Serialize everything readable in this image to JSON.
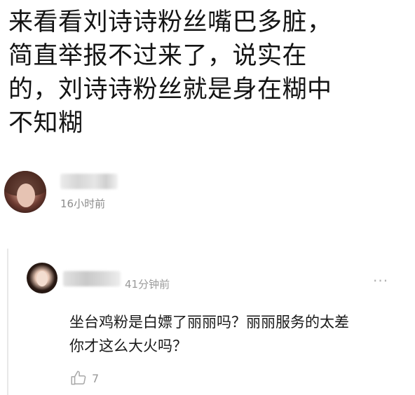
{
  "post": {
    "lines": [
      "来看看刘诗诗粉丝嘴巴多脏，",
      "简直举报不过来了，说实在",
      "的，刘诗诗粉丝就是身在糊中",
      "不知糊"
    ]
  },
  "author": {
    "time": "16小时前"
  },
  "reply": {
    "time": "41分钟前",
    "more_label": "···",
    "lines": [
      "坐台鸡粉是白嫖了丽丽吗？丽丽服务的太差",
      "你才这么大火吗？"
    ],
    "like_count": "7"
  },
  "icons": {
    "more": "more-horizontal-icon",
    "like": "thumbs-up-icon"
  }
}
